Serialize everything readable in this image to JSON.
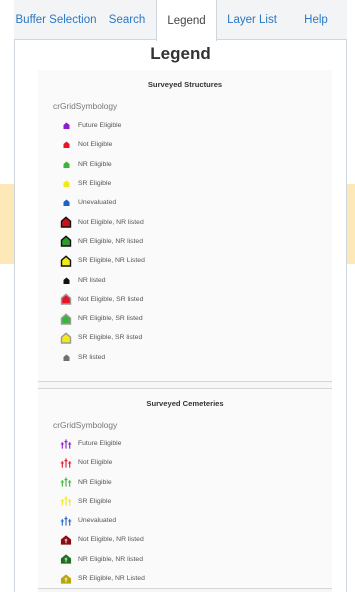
{
  "tabs": [
    {
      "label": "Buffer Selection",
      "active": false
    },
    {
      "label": "Search",
      "active": false
    },
    {
      "label": "Legend",
      "active": true
    },
    {
      "label": "Layer List",
      "active": false
    },
    {
      "label": "Help",
      "active": false
    }
  ],
  "panel": {
    "title": "Legend"
  },
  "sections": [
    {
      "title": "Surveyed Structures",
      "symbology": "crGridSymbology",
      "items": [
        {
          "label": "Future Eligible",
          "color": "#8b1fc8",
          "icon": "small-house-icon"
        },
        {
          "label": "Not Eligible",
          "color": "#e5162a",
          "icon": "small-house-icon"
        },
        {
          "label": "NR Eligible",
          "color": "#3cb43a",
          "icon": "small-house-icon"
        },
        {
          "label": "SR Eligible",
          "color": "#f2ea16",
          "icon": "small-house-icon"
        },
        {
          "label": "Unevaluated",
          "color": "#1d63c8",
          "icon": "small-house-icon"
        },
        {
          "label": "Not Eligible, NR listed",
          "color": "#c81018",
          "icon": "outlined-house-icon"
        },
        {
          "label": "NR Eligible, NR listed",
          "color": "#2e9a2c",
          "icon": "outlined-house-icon"
        },
        {
          "label": "SR Eligible, NR Listed",
          "color": "#f2ea16",
          "icon": "outlined-house-icon"
        },
        {
          "label": "NR listed",
          "color": "#111111",
          "icon": "small-house-icon"
        },
        {
          "label": "Not Eligible, SR listed",
          "color": "#e5162a",
          "icon": "gray-outlined-house-icon"
        },
        {
          "label": "NR Eligible, SR listed",
          "color": "#3cb43a",
          "icon": "gray-outlined-house-icon"
        },
        {
          "label": "SR Eligible, SR listed",
          "color": "#f2ea16",
          "icon": "gray-outlined-house-icon"
        },
        {
          "label": "SR listed",
          "color": "#707070",
          "icon": "small-house-icon"
        }
      ]
    },
    {
      "title": "Surveyed Cemeteries",
      "symbology": "crGridSymbology",
      "items": [
        {
          "label": "Future Eligible",
          "color": "#8b1fc8",
          "icon": "crosses-icon"
        },
        {
          "label": "Not Eligible",
          "color": "#e5162a",
          "icon": "crosses-icon"
        },
        {
          "label": "NR Eligible",
          "color": "#3cb43a",
          "icon": "crosses-icon"
        },
        {
          "label": "SR Eligible",
          "color": "#f2ea16",
          "icon": "crosses-icon"
        },
        {
          "label": "Unevaluated",
          "color": "#1d63c8",
          "icon": "crosses-icon"
        },
        {
          "label": "Not Eligible, NR listed",
          "color": "#8b0a10",
          "icon": "cemetery-house-icon"
        },
        {
          "label": "NR Eligible, NR listed",
          "color": "#1f6d1d",
          "icon": "cemetery-house-icon"
        },
        {
          "label": "SR Eligible, NR Listed",
          "color": "#b8a60e",
          "icon": "cemetery-house-icon"
        }
      ]
    }
  ]
}
